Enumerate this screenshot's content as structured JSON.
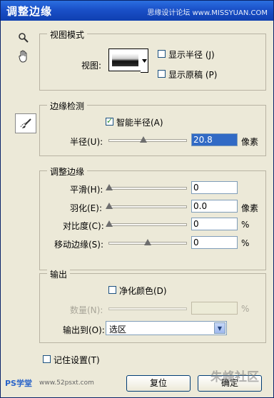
{
  "window": {
    "title": "调整边缘",
    "watermark": "思缘设计论坛 www.MISSYUAN.COM"
  },
  "tools": {
    "zoom": "search-icon",
    "hand": "hand-icon",
    "refine_brush": "refine-radius-brush-icon"
  },
  "view_mode": {
    "title": "视图模式",
    "view_label": "视图:",
    "show_radius": {
      "label": "显示半径 (J)",
      "checked": false
    },
    "show_original": {
      "label": "显示原稿 (P)",
      "checked": false
    }
  },
  "edge_detection": {
    "title": "边缘检测",
    "smart_radius": {
      "label": "智能半径(A)",
      "checked": true
    },
    "radius": {
      "label": "半径(U):",
      "value": "20.8",
      "unit": "像素",
      "level": 0.33
    }
  },
  "adjust_edge": {
    "title": "调整边缘",
    "smooth": {
      "label": "平滑(H):",
      "value": "0",
      "unit": "",
      "level": 0
    },
    "feather": {
      "label": "羽化(E):",
      "value": "0.0",
      "unit": "像素",
      "level": 0
    },
    "contrast": {
      "label": "对比度(C):",
      "value": "0",
      "unit": "%",
      "level": 0
    },
    "shift_edge": {
      "label": "移动边缘(S):",
      "value": "0",
      "unit": "%",
      "level": 0.5
    }
  },
  "output": {
    "title": "输出",
    "decontaminate": {
      "label": "净化颜色(D)",
      "checked": false
    },
    "amount": {
      "label": "数量(N):",
      "value": "",
      "unit": "%"
    },
    "output_to": {
      "label": "输出到(O):",
      "value": "选区"
    }
  },
  "remember": {
    "label": "记住设置(T)",
    "checked": false
  },
  "buttons": {
    "reset": "复位",
    "ok": "确定"
  },
  "logos": {
    "left": "PS学堂",
    "left_url": "www.52psxt.com",
    "right": "朱峰社区"
  },
  "colors": {
    "titlebar": "#1a50c8",
    "accent": "#316ac5",
    "background": "#ece9d8"
  }
}
